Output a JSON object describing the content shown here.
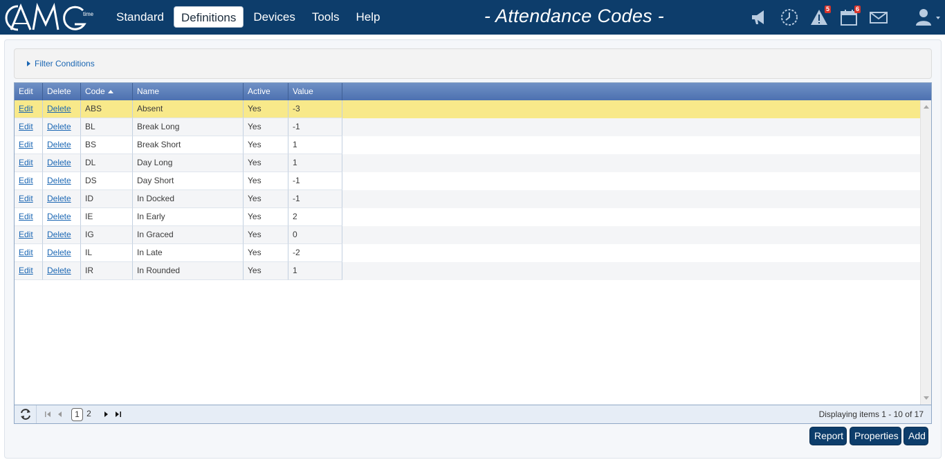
{
  "app": {
    "logo_text": "AMG",
    "logo_sub": "time"
  },
  "nav": {
    "items": [
      "Standard",
      "Definitions",
      "Devices",
      "Tools",
      "Help"
    ],
    "active": "Definitions"
  },
  "page": {
    "title": "- Attendance Codes -"
  },
  "top_icons": [
    {
      "name": "megaphone-icon"
    },
    {
      "name": "clock-icon"
    },
    {
      "name": "alert-icon",
      "badge": "5"
    },
    {
      "name": "calendar-icon",
      "badge": "6"
    },
    {
      "name": "mail-icon"
    },
    {
      "name": "user-icon"
    }
  ],
  "filter": {
    "label": "Filter Conditions"
  },
  "grid": {
    "columns": {
      "edit": "Edit",
      "delete": "Delete",
      "code": "Code",
      "name": "Name",
      "active": "Active",
      "value": "Value"
    },
    "rows": [
      {
        "edit": "Edit",
        "delete": "Delete",
        "code": "ABS",
        "name": "Absent",
        "active": "Yes",
        "value": "-3"
      },
      {
        "edit": "Edit",
        "delete": "Delete",
        "code": "BL",
        "name": "Break Long",
        "active": "Yes",
        "value": "-1"
      },
      {
        "edit": "Edit",
        "delete": "Delete",
        "code": "BS",
        "name": "Break Short",
        "active": "Yes",
        "value": "1"
      },
      {
        "edit": "Edit",
        "delete": "Delete",
        "code": "DL",
        "name": "Day Long",
        "active": "Yes",
        "value": "1"
      },
      {
        "edit": "Edit",
        "delete": "Delete",
        "code": "DS",
        "name": "Day Short",
        "active": "Yes",
        "value": "-1"
      },
      {
        "edit": "Edit",
        "delete": "Delete",
        "code": "ID",
        "name": "In Docked",
        "active": "Yes",
        "value": "-1"
      },
      {
        "edit": "Edit",
        "delete": "Delete",
        "code": "IE",
        "name": "In Early",
        "active": "Yes",
        "value": "2"
      },
      {
        "edit": "Edit",
        "delete": "Delete",
        "code": "IG",
        "name": "In Graced",
        "active": "Yes",
        "value": "0"
      },
      {
        "edit": "Edit",
        "delete": "Delete",
        "code": "IL",
        "name": "In Late",
        "active": "Yes",
        "value": "-2"
      },
      {
        "edit": "Edit",
        "delete": "Delete",
        "code": "IR",
        "name": "In Rounded",
        "active": "Yes",
        "value": "1"
      }
    ]
  },
  "pager": {
    "pages": [
      "1",
      "2"
    ],
    "current": "1",
    "info": "Displaying items 1 - 10 of 17"
  },
  "actions": {
    "report": "Report",
    "properties": "Properties",
    "add": "Add"
  },
  "colors": {
    "brand": "#0d3d6b",
    "header": "#5a7cb8",
    "selected_row": "#f8e98a",
    "link": "#1a66b3",
    "badge": "#d9342b"
  }
}
